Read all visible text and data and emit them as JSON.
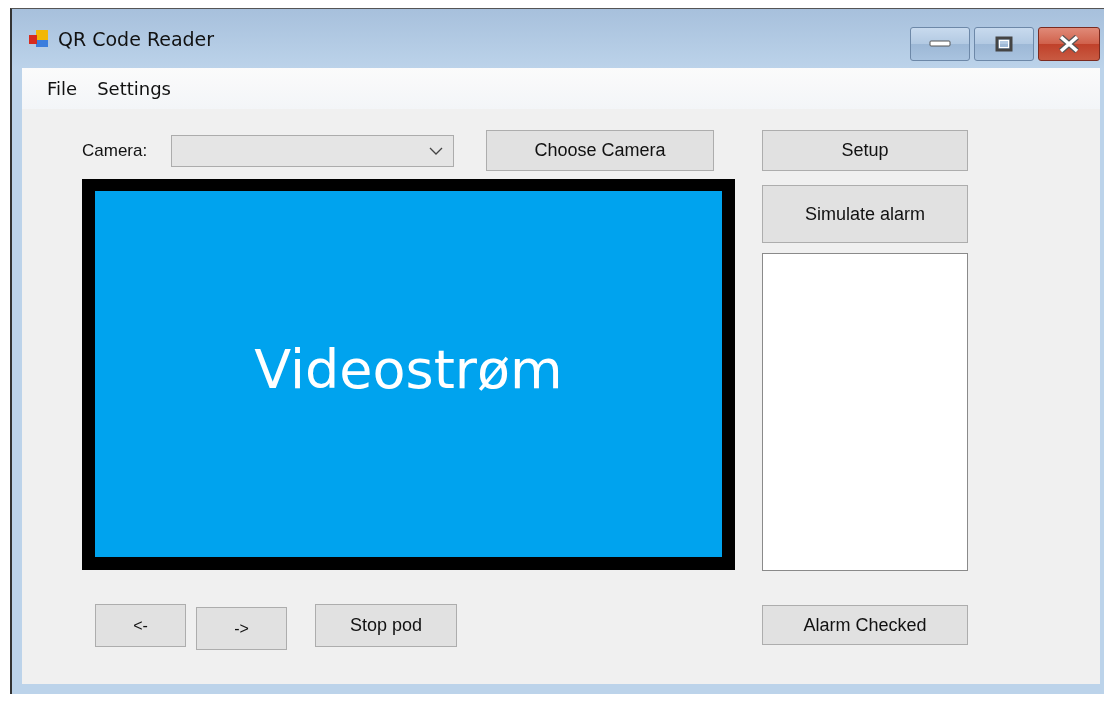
{
  "window": {
    "title": "QR Code Reader"
  },
  "menu": [
    "File",
    "Settings"
  ],
  "camera": {
    "label": "Camera:"
  },
  "buttons_top": [
    "Choose Camera"
  ],
  "video": {
    "kind": "picture",
    "caption": "Videostrøm"
  },
  "nav_buttons": [
    "<-",
    "->",
    "Stop pod"
  ],
  "side_buttons": [
    "Setup",
    "Simulate alarm"
  ],
  "alarm_button": "Alarm Checked"
}
